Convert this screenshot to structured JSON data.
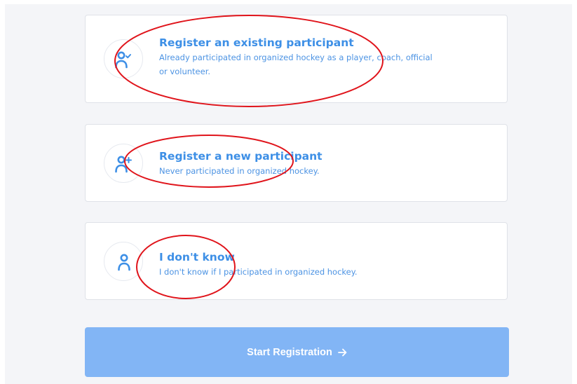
{
  "options": [
    {
      "title": "Register an existing participant",
      "description": "Already participated in organized hockey as a player, coach, official or volunteer.",
      "icon": "person-check-icon"
    },
    {
      "title": "Register a new participant",
      "description": "Never participated in organized hockey.",
      "icon": "person-plus-icon"
    },
    {
      "title": "I don't know",
      "description": "I don't know if I participated in organized hockey.",
      "icon": "person-icon"
    }
  ],
  "start_button": {
    "label": "Start Registration",
    "icon": "arrow-right-icon"
  },
  "colors": {
    "accent": "#3d8fe6",
    "button": "#82b5f5",
    "annotation": "#e0141b",
    "background": "#f4f5f8"
  }
}
